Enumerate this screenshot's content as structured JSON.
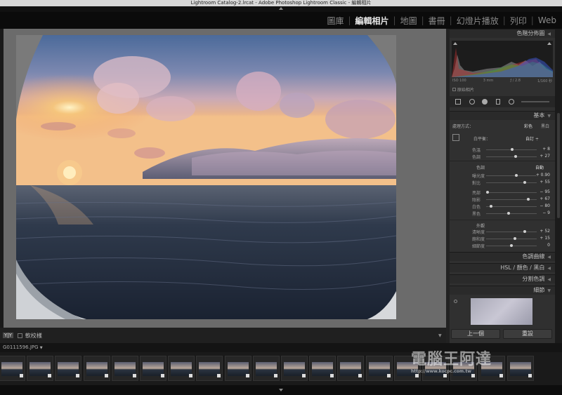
{
  "window": {
    "title": "Lightroom Catalog-2.lrcat - Adobe Photoshop Lightroom Classic - 編輯相片"
  },
  "modules": [
    {
      "label": "圖庫",
      "active": false
    },
    {
      "label": "編輯相片",
      "active": true
    },
    {
      "label": "地圖",
      "active": false
    },
    {
      "label": "書冊",
      "active": false
    },
    {
      "label": "幻燈片播放",
      "active": false
    },
    {
      "label": "列印",
      "active": false
    },
    {
      "label": "Web",
      "active": false
    }
  ],
  "panel": {
    "histogram": {
      "title": "色階分佈圖",
      "info": [
        "ISO 100",
        "3 mm",
        "ƒ / 2.8",
        "1/160 秒"
      ],
      "original_label": "原始相片"
    },
    "basic": {
      "title": "基本",
      "treatment_label": "處理方式：",
      "treatment_color": "彩色",
      "treatment_bw": "黑白",
      "wb_label": "白平衡：",
      "wb_value": "自訂 ÷",
      "sliders_wb": [
        {
          "label": "色溫",
          "value": "+ 8",
          "pos": 0.52
        },
        {
          "label": "色調",
          "value": "+ 27",
          "pos": 0.58
        }
      ],
      "tone_label": "色調",
      "tone_auto": "自動",
      "sliders_tone1": [
        {
          "label": "曝光度",
          "value": "+ 0.90",
          "pos": 0.6
        },
        {
          "label": "對比",
          "value": "+ 55",
          "pos": 0.77
        }
      ],
      "sliders_tone2": [
        {
          "label": "亮部",
          "value": "− 95",
          "pos": 0.03
        },
        {
          "label": "陰影",
          "value": "+ 67",
          "pos": 0.83
        },
        {
          "label": "白色",
          "value": "− 80",
          "pos": 0.1
        },
        {
          "label": "黑色",
          "value": "− 9",
          "pos": 0.45
        }
      ],
      "presence_label": "外觀",
      "sliders_presence": [
        {
          "label": "清晰度",
          "value": "+ 52",
          "pos": 0.76
        },
        {
          "label": "飽和度",
          "value": "+ 15",
          "pos": 0.57
        },
        {
          "label": "細節度",
          "value": "0",
          "pos": 0.5
        }
      ]
    },
    "sections": [
      "色調曲線",
      "HSL / 顏色 / 黑白",
      "分割色調",
      "細節"
    ],
    "prev_button": "上一個",
    "reset_button": "重設"
  },
  "toolbar": {
    "proof_label": "軟校樣"
  },
  "filmstrip": {
    "filename": "G0111596.JPG",
    "thumb_count": 19
  },
  "watermark": {
    "text": "電腦王阿達",
    "url": "http://www.kocpc.com.tw"
  }
}
